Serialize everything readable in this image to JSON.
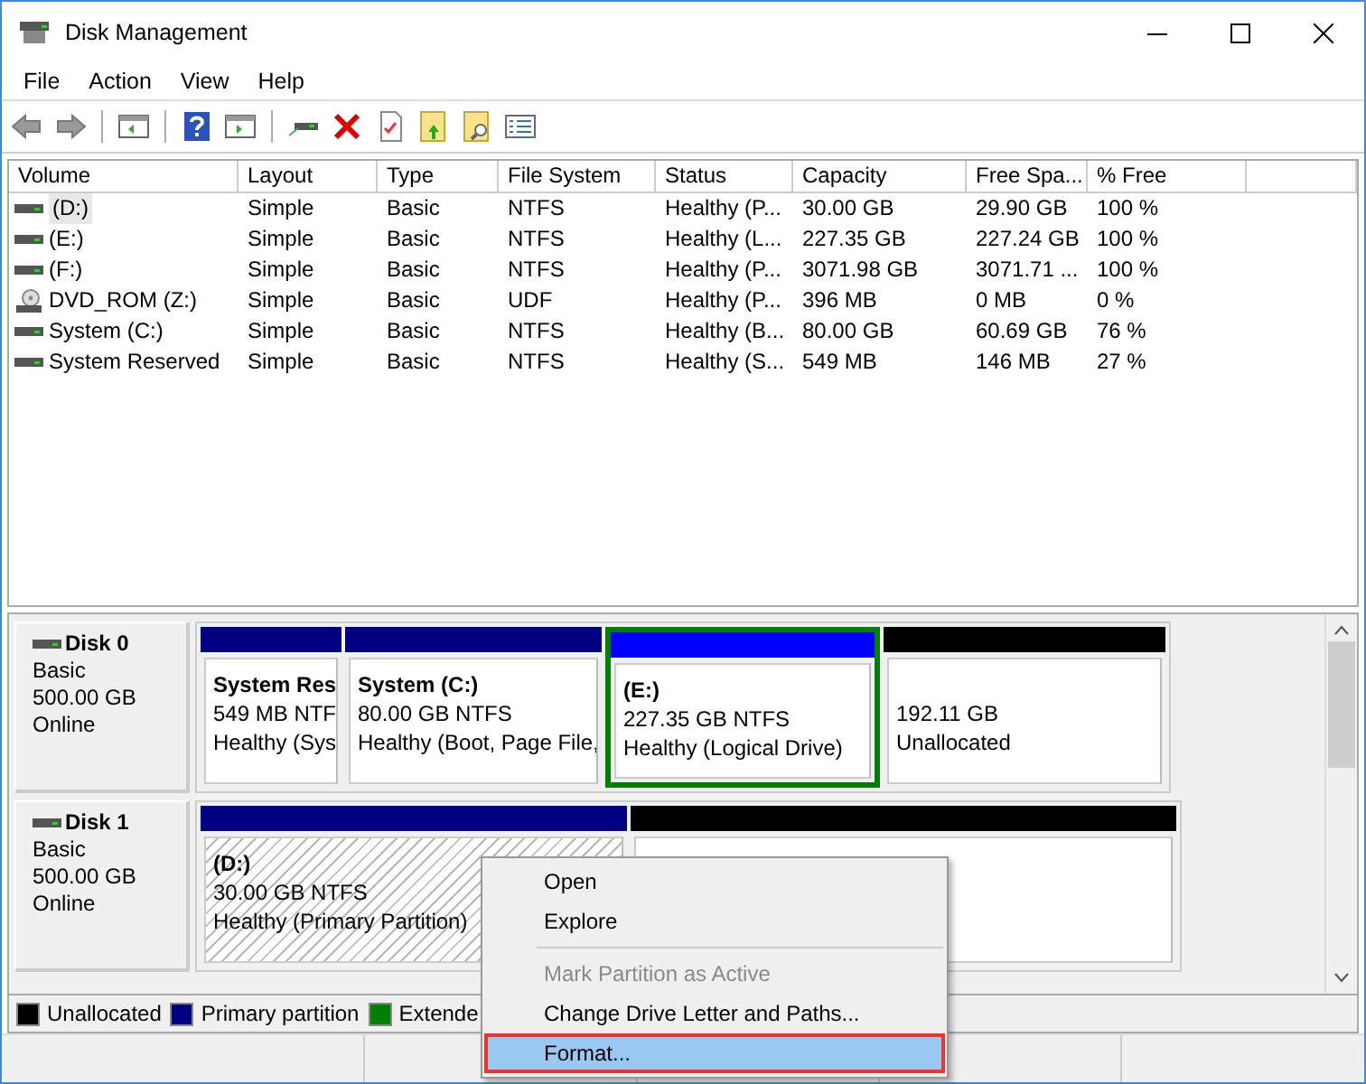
{
  "window": {
    "title": "Disk Management"
  },
  "menu": [
    "File",
    "Action",
    "View",
    "Help"
  ],
  "table": {
    "columns": [
      "Volume",
      "Layout",
      "Type",
      "File System",
      "Status",
      "Capacity",
      "Free Spa...",
      "% Free"
    ],
    "rows": [
      {
        "kind": "disk",
        "selected": true,
        "cells": [
          "(D:)",
          "Simple",
          "Basic",
          "NTFS",
          "Healthy (P...",
          "30.00 GB",
          "29.90 GB",
          "100 %"
        ]
      },
      {
        "kind": "disk",
        "selected": false,
        "cells": [
          "(E:)",
          "Simple",
          "Basic",
          "NTFS",
          "Healthy (L...",
          "227.35 GB",
          "227.24 GB",
          "100 %"
        ]
      },
      {
        "kind": "disk",
        "selected": false,
        "cells": [
          "(F:)",
          "Simple",
          "Basic",
          "NTFS",
          "Healthy (P...",
          "3071.98 GB",
          "3071.71 ...",
          "100 %"
        ]
      },
      {
        "kind": "optical",
        "selected": false,
        "cells": [
          "DVD_ROM (Z:)",
          "Simple",
          "Basic",
          "UDF",
          "Healthy (P...",
          "396 MB",
          "0 MB",
          "0 %"
        ]
      },
      {
        "kind": "disk",
        "selected": false,
        "cells": [
          "System (C:)",
          "Simple",
          "Basic",
          "NTFS",
          "Healthy (B...",
          "80.00 GB",
          "60.69 GB",
          "76 %"
        ]
      },
      {
        "kind": "disk",
        "selected": false,
        "cells": [
          "System Reserved",
          "Simple",
          "Basic",
          "NTFS",
          "Healthy (S...",
          "549 MB",
          "146 MB",
          "27 %"
        ]
      }
    ]
  },
  "disks": [
    {
      "name": "Disk 0",
      "type": "Basic",
      "size": "500.00 GB",
      "status": "Online",
      "partitions": [
        {
          "kind": "primary",
          "color": "#000080",
          "selected": false,
          "title": "System Res",
          "lines": [
            "549 MB NTF",
            "Healthy (Sys"
          ]
        },
        {
          "kind": "primary",
          "color": "#000080",
          "selected": false,
          "title": "System  (C:)",
          "lines": [
            "80.00 GB NTFS",
            "Healthy (Boot, Page File,"
          ]
        },
        {
          "kind": "logical",
          "color": "#0000ff",
          "selected": false,
          "title": "(E:)",
          "lines": [
            "227.35 GB NTFS",
            "Healthy (Logical Drive)"
          ]
        },
        {
          "kind": "unallocated",
          "color": "#000000",
          "selected": false,
          "lines": [
            "192.11 GB",
            "Unallocated"
          ]
        }
      ]
    },
    {
      "name": "Disk 1",
      "type": "Basic",
      "size": "500.00 GB",
      "status": "Online",
      "partitions": [
        {
          "kind": "primary",
          "color": "#000080",
          "selected": true,
          "title": "(D:)",
          "lines": [
            "30.00 GB NTFS",
            "Healthy (Primary Partition)"
          ]
        },
        {
          "kind": "unallocated",
          "color": "#000000",
          "selected": false
        }
      ]
    }
  ],
  "legend": [
    {
      "label": "Unallocated",
      "color": "#000000"
    },
    {
      "label": "Primary partition",
      "color": "#000080"
    },
    {
      "label": "Extende",
      "color": "#008000"
    }
  ],
  "context_menu": [
    {
      "kind": "item",
      "label": "Open",
      "disabled": false,
      "selected": false
    },
    {
      "kind": "item",
      "label": "Explore",
      "disabled": false,
      "selected": false
    },
    {
      "kind": "separator"
    },
    {
      "kind": "item",
      "label": "Mark Partition as Active",
      "disabled": true,
      "selected": false
    },
    {
      "kind": "item",
      "label": "Change Drive Letter and Paths...",
      "disabled": false,
      "selected": false
    },
    {
      "kind": "item",
      "label": "Format...",
      "disabled": false,
      "selected": true
    }
  ]
}
